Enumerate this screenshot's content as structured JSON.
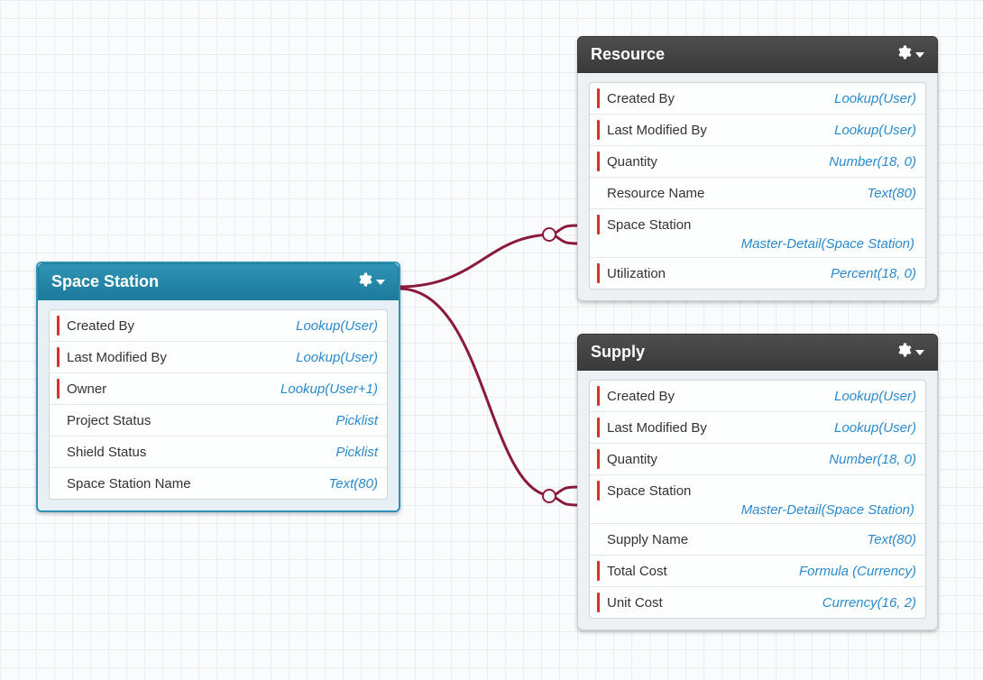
{
  "entities": {
    "space_station": {
      "title": "Space Station",
      "fields": [
        {
          "name": "Created By",
          "type": "Lookup(User)",
          "accent": true
        },
        {
          "name": "Last Modified By",
          "type": "Lookup(User)",
          "accent": true
        },
        {
          "name": "Owner",
          "type": "Lookup(User+1)",
          "accent": true
        },
        {
          "name": "Project Status",
          "type": "Picklist",
          "accent": false
        },
        {
          "name": "Shield Status",
          "type": "Picklist",
          "accent": false
        },
        {
          "name": "Space Station Name",
          "type": "Text(80)",
          "accent": false
        }
      ]
    },
    "resource": {
      "title": "Resource",
      "fields": [
        {
          "name": "Created By",
          "type": "Lookup(User)",
          "accent": true
        },
        {
          "name": "Last Modified By",
          "type": "Lookup(User)",
          "accent": true
        },
        {
          "name": "Quantity",
          "type": "Number(18, 0)",
          "accent": true
        },
        {
          "name": "Resource Name",
          "type": "Text(80)",
          "accent": false
        },
        {
          "name": "Space Station",
          "type": "Master-Detail(Space Station)",
          "accent": true,
          "wrap": true
        },
        {
          "name": "Utilization",
          "type": "Percent(18, 0)",
          "accent": true
        }
      ]
    },
    "supply": {
      "title": "Supply",
      "fields": [
        {
          "name": "Created By",
          "type": "Lookup(User)",
          "accent": true
        },
        {
          "name": "Last Modified By",
          "type": "Lookup(User)",
          "accent": true
        },
        {
          "name": "Quantity",
          "type": "Number(18, 0)",
          "accent": true
        },
        {
          "name": "Space Station",
          "type": "Master-Detail(Space Station)",
          "accent": true,
          "wrap": true
        },
        {
          "name": "Supply Name",
          "type": "Text(80)",
          "accent": false
        },
        {
          "name": "Total Cost",
          "type": "Formula (Currency)",
          "accent": true
        },
        {
          "name": "Unit Cost",
          "type": "Currency(16, 2)",
          "accent": true
        }
      ]
    }
  },
  "colors": {
    "connector": "#8b1a3a",
    "link": "#2b8acb"
  }
}
